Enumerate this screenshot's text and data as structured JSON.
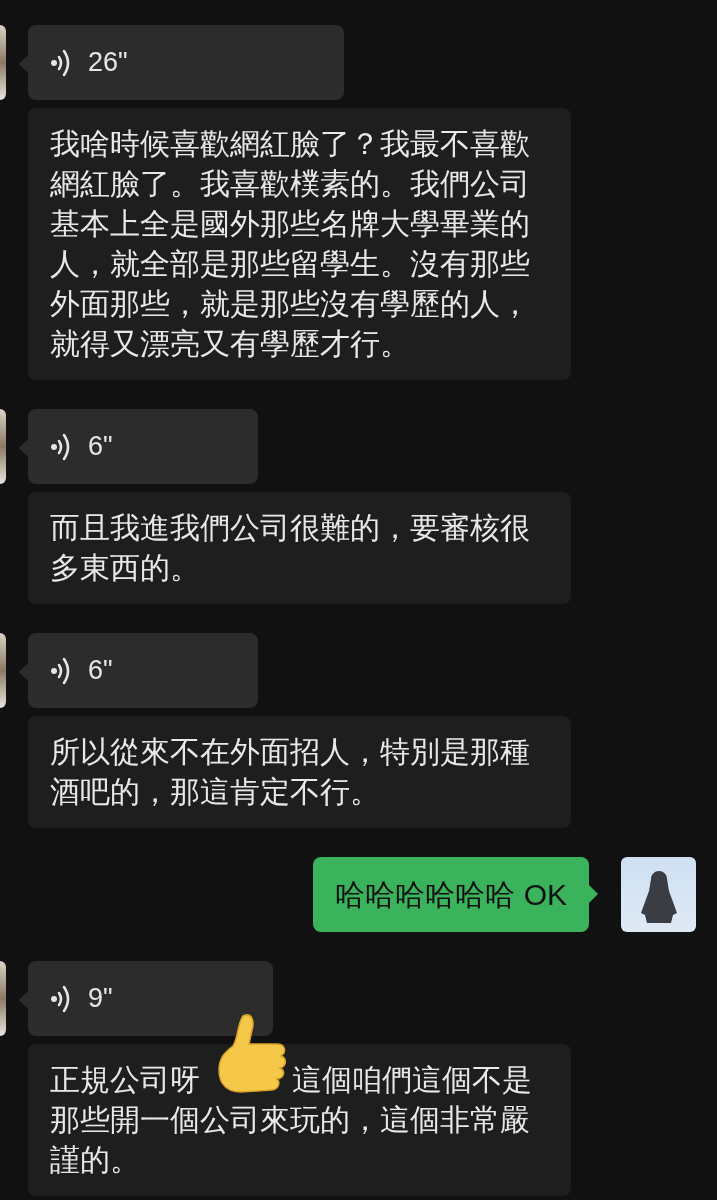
{
  "messages": [
    {
      "kind": "voice",
      "duration": "26\""
    },
    {
      "kind": "transcript",
      "text": "我啥時候喜歡網紅臉了？我最不喜歡網紅臉了。我喜歡樸素的。我們公司基本上全是國外那些名牌大學畢業的人，就全部是那些留學生。沒有那些外面那些，就是那些沒有學歷的人，就得又漂亮又有學歷才行。"
    },
    {
      "kind": "voice",
      "duration": "6\""
    },
    {
      "kind": "transcript",
      "text": "而且我進我們公司很難的，要審核很多東西的。"
    },
    {
      "kind": "voice",
      "duration": "6\""
    },
    {
      "kind": "transcript",
      "text": "所以從來不在外面招人，特別是那種酒吧的，那這肯定不行。"
    },
    {
      "kind": "text",
      "text": "哈哈哈哈哈哈 OK"
    },
    {
      "kind": "voice",
      "duration": "9\""
    },
    {
      "kind": "transcript_emoji",
      "text": "正規公司呀",
      "text_after": "這個咱們這個不是那些開一個公司來玩的，這個非常嚴謹的。"
    }
  ]
}
